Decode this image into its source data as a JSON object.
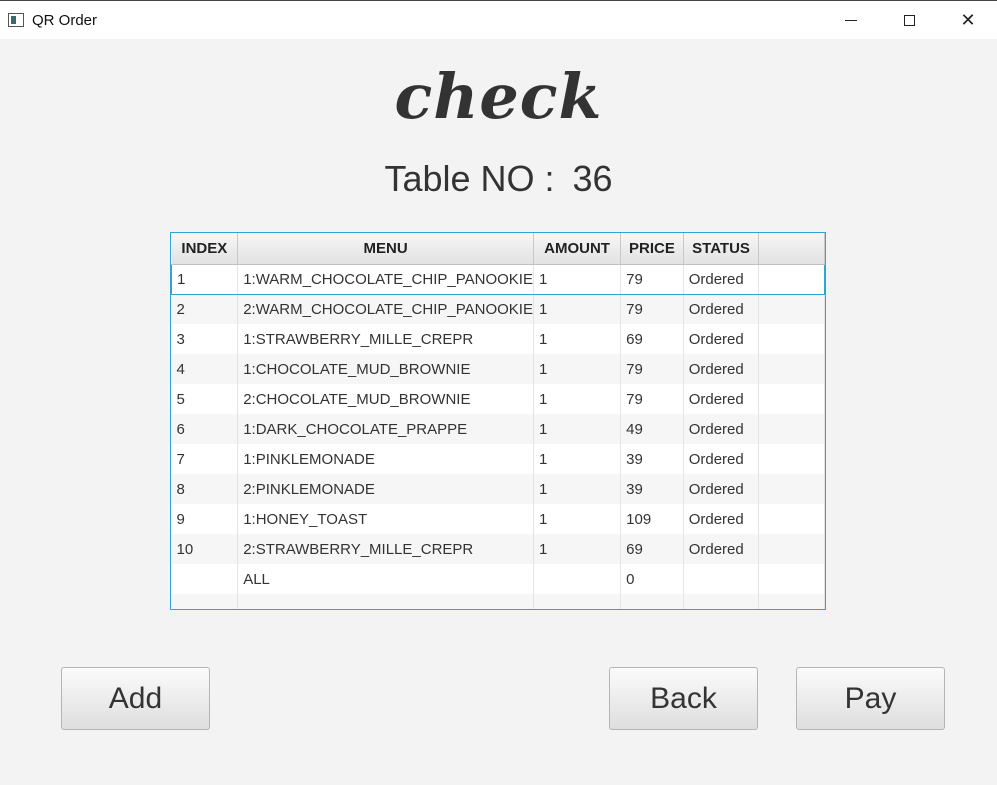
{
  "window": {
    "title": "QR Order",
    "close_glyph": "✕"
  },
  "heading": "check",
  "table_no": {
    "label": "Table NO :",
    "value": "36"
  },
  "orders": {
    "columns": [
      "INDEX",
      "MENU",
      "AMOUNT",
      "PRICE",
      "STATUS",
      ""
    ],
    "rows": [
      [
        "1",
        "1:WARM_CHOCOLATE_CHIP_PANOOKIE",
        "1",
        "79",
        "Ordered",
        ""
      ],
      [
        "2",
        "2:WARM_CHOCOLATE_CHIP_PANOOKIE",
        "1",
        "79",
        "Ordered",
        ""
      ],
      [
        "3",
        "1:STRAWBERRY_MILLE_CREPR",
        "1",
        "69",
        "Ordered",
        ""
      ],
      [
        "4",
        "1:CHOCOLATE_MUD_BROWNIE",
        "1",
        "79",
        "Ordered",
        ""
      ],
      [
        "5",
        "2:CHOCOLATE_MUD_BROWNIE",
        "1",
        "79",
        "Ordered",
        ""
      ],
      [
        "6",
        "1:DARK_CHOCOLATE_PRAPPE",
        "1",
        "49",
        "Ordered",
        ""
      ],
      [
        "7",
        "1:PINKLEMONADE",
        "1",
        "39",
        "Ordered",
        ""
      ],
      [
        "8",
        "2:PINKLEMONADE",
        "1",
        "39",
        "Ordered",
        ""
      ],
      [
        "9",
        "1:HONEY_TOAST",
        "1",
        "109",
        "Ordered",
        ""
      ],
      [
        "10",
        "2:STRAWBERRY_MILLE_CREPR",
        "1",
        "69",
        "Ordered",
        ""
      ],
      [
        "",
        "ALL",
        "",
        "0",
        "",
        ""
      ],
      [
        "",
        "",
        "",
        "",
        "",
        ""
      ]
    ],
    "selected_row": 0,
    "accent_color": "#2aa7d8"
  },
  "buttons": {
    "add": "Add",
    "back": "Back",
    "pay": "Pay"
  }
}
